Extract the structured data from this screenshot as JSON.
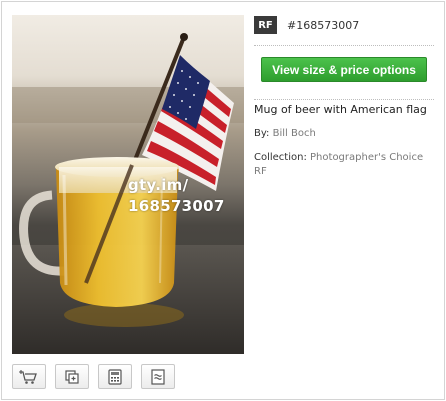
{
  "badge": {
    "label": "RF"
  },
  "image_id": "#168573007",
  "price_button": {
    "label": "View size & price options"
  },
  "caption": "Mug of beer with American flag",
  "byline": {
    "label": "By:",
    "photographer": "Bill Boch"
  },
  "collection": {
    "label": "Collection:",
    "name": "Photographer's Choice RF"
  },
  "watermark": {
    "line1": "gty.im/",
    "line2": "168573007"
  },
  "toolbar": {
    "icons": [
      "add-to-cart-icon",
      "add-to-lightbox-icon",
      "price-calculator-icon",
      "compare-icon"
    ]
  },
  "colors": {
    "button_green": "#3bb13b",
    "badge_dark": "#3a3a3a",
    "link_gray": "#7a7a7a"
  }
}
